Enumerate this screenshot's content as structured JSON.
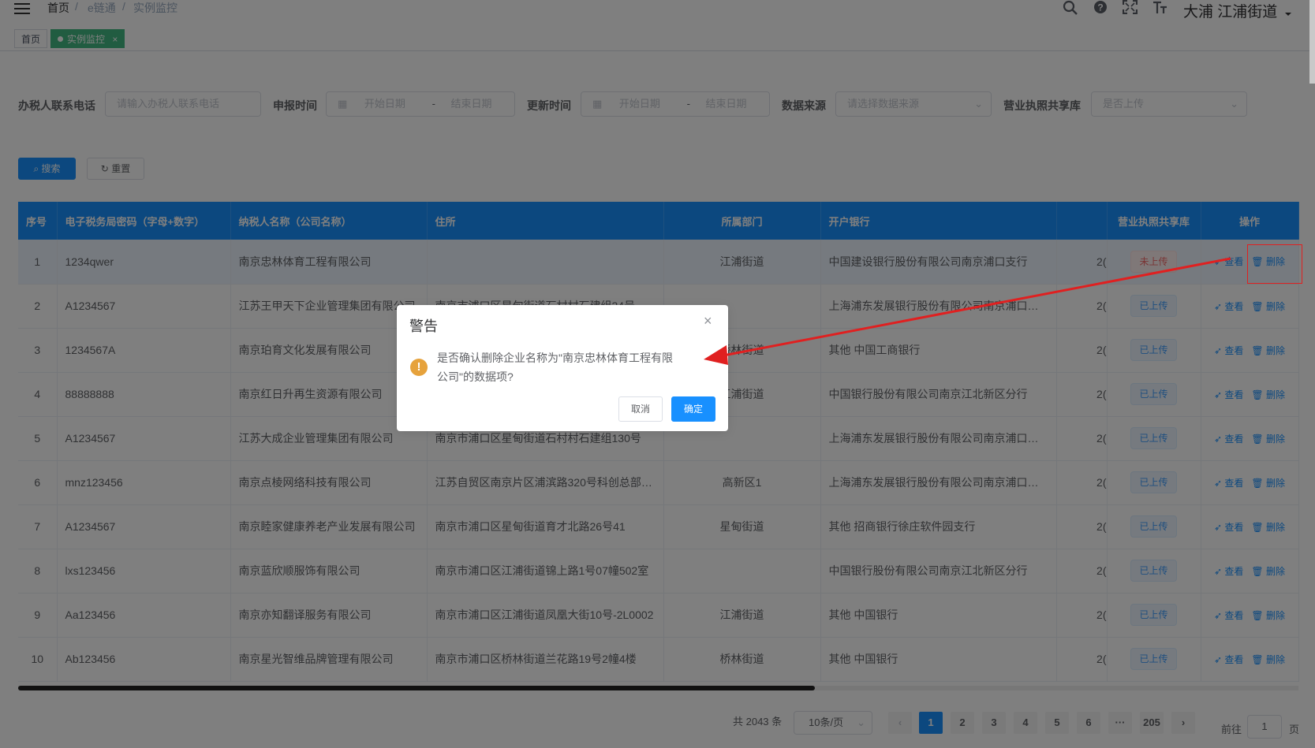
{
  "header": {
    "breadcrumb": [
      "首页",
      "e链通",
      "实例监控"
    ],
    "breadcrumb_sep": "/",
    "user_name": "大浦  江浦街道",
    "icons": [
      "search-icon",
      "question-icon",
      "fullscreen-icon",
      "font-size-icon"
    ]
  },
  "tags": {
    "home": "首页",
    "active": "实例监控",
    "close": "×"
  },
  "filters": {
    "phone_label": "办税人联系电话",
    "phone_placeholder": "请输入办税人联系电话",
    "report_time_label": "申报时间",
    "update_time_label": "更新时间",
    "start_placeholder": "开始日期",
    "end_placeholder": "结束日期",
    "range_sep": "-",
    "source_label": "数据来源",
    "source_placeholder": "请选择数据来源",
    "license_label": "营业执照共享库",
    "license_placeholder": "是否上传",
    "search_btn": "搜索",
    "reset_btn": "重置"
  },
  "table": {
    "headers": [
      "序号",
      "电子税务局密码（字母+数字）",
      "纳税人名称（公司名称）",
      "住所",
      "所属部门",
      "开户银行",
      "",
      "营业执照共享库",
      "操作"
    ],
    "view_label": "查看",
    "delete_label": "删除",
    "rows": [
      {
        "no": "1",
        "pwd": "1234qwer",
        "name": "南京忠林体育工程有限公司",
        "addr": "",
        "dept": "江浦街道",
        "bank": "中国建设银行股份有限公司南京浦口支行",
        "col7": "2(",
        "status": "未上传"
      },
      {
        "no": "2",
        "pwd": "A1234567",
        "name": "江苏王甲天下企业管理集团有限公司",
        "addr": "南京市浦口区星甸街道石村村石建组34号",
        "dept": "",
        "bank": "上海浦东发展银行股份有限公司南京浦口…",
        "col7": "2(",
        "status": "已上传"
      },
      {
        "no": "3",
        "pwd": "1234567A",
        "name": "南京珀育文化发展有限公司",
        "addr": "",
        "dept": "桥林街道",
        "bank": "其他  中国工商银行",
        "col7": "2(",
        "status": "已上传"
      },
      {
        "no": "4",
        "pwd": "88888888",
        "name": "南京红日升再生资源有限公司",
        "addr": "",
        "dept": "江浦街道",
        "bank": "中国银行股份有限公司南京江北新区分行",
        "col7": "2(",
        "status": "已上传"
      },
      {
        "no": "5",
        "pwd": "A1234567",
        "name": "江苏大成企业管理集团有限公司",
        "addr": "南京市浦口区星甸街道石村村石建组130号",
        "dept": "",
        "bank": "上海浦东发展银行股份有限公司南京浦口…",
        "col7": "2(",
        "status": "已上传"
      },
      {
        "no": "6",
        "pwd": "mnz123456",
        "name": "南京点棱网络科技有限公司",
        "addr": "江苏自贸区南京片区浦滨路320号科创总部…",
        "dept": "高新区1",
        "bank": "上海浦东发展银行股份有限公司南京浦口…",
        "col7": "2(",
        "status": "已上传"
      },
      {
        "no": "7",
        "pwd": "A1234567",
        "name": "南京睦家健康养老产业发展有限公司",
        "addr": "南京市浦口区星甸街道育才北路26号41",
        "dept": "星甸街道",
        "bank": "其他  招商银行徐庄软件园支行",
        "col7": "2(",
        "status": "已上传"
      },
      {
        "no": "8",
        "pwd": "lxs123456",
        "name": "南京蓝欣顺服饰有限公司",
        "addr": "南京市浦口区江浦街道锦上路1号07幢502室",
        "dept": "",
        "bank": "中国银行股份有限公司南京江北新区分行",
        "col7": "2(",
        "status": "已上传"
      },
      {
        "no": "9",
        "pwd": "Aa123456",
        "name": "南京亦知翻译服务有限公司",
        "addr": "南京市浦口区江浦街道凤凰大街10号-2L0002",
        "dept": "江浦街道",
        "bank": "其他  中国银行",
        "col7": "2(",
        "status": "已上传"
      },
      {
        "no": "10",
        "pwd": "Ab123456",
        "name": "南京星光智维品牌管理有限公司",
        "addr": "南京市浦口区桥林街道兰花路19号2幢4楼",
        "dept": "桥林街道",
        "bank": "其他  中国银行",
        "col7": "2(",
        "status": "已上传"
      }
    ]
  },
  "pagination": {
    "total": "共 2043 条",
    "page_size": "10条/页",
    "pages": [
      "1",
      "2",
      "3",
      "4",
      "5",
      "6",
      "···",
      "205"
    ],
    "goto_prefix": "前往",
    "goto_value": "1",
    "goto_suffix": "页",
    "prev": "‹",
    "next": "›"
  },
  "dialog": {
    "title": "警告",
    "message": "是否确认删除企业名称为\"南京忠林体育工程有限公司\"的数据项?",
    "cancel": "取消",
    "confirm": "确定",
    "close": "×",
    "icon": "!"
  },
  "colors": {
    "primary": "#1890ff",
    "warning": "#e6a23c",
    "danger": "#f56c6c",
    "tag_active": "#42b983",
    "annotation": "#e02020"
  }
}
